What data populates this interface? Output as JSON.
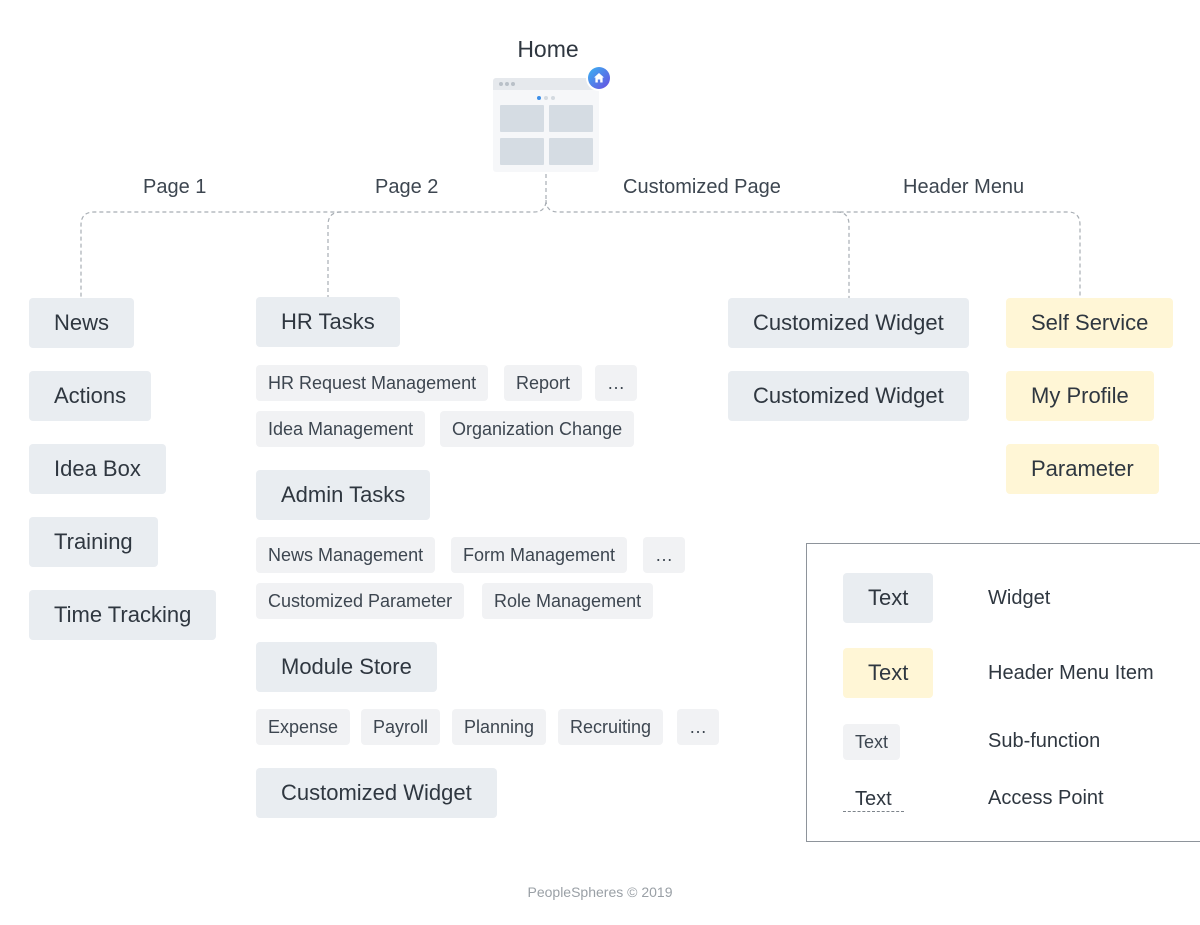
{
  "home": {
    "title": "Home",
    "icon": "home-icon"
  },
  "branches": {
    "page1": "Page 1",
    "page2": "Page 2",
    "customized_page": "Customized Page",
    "header_menu": "Header Menu"
  },
  "page1_widgets": [
    "News",
    "Actions",
    "Idea Box",
    "Training",
    "Time Tracking"
  ],
  "page2": {
    "hr_tasks": {
      "label": "HR Tasks",
      "subs": [
        "HR Request Management",
        "Report",
        "…",
        "Idea Management",
        "Organization Change"
      ]
    },
    "admin_tasks": {
      "label": "Admin Tasks",
      "subs": [
        "News Management",
        "Form Management",
        "…",
        "Customized Parameter",
        "Role Management"
      ]
    },
    "module_store": {
      "label": "Module Store",
      "subs": [
        "Expense",
        "Payroll",
        "Planning",
        "Recruiting",
        "…"
      ]
    },
    "customized_widget": "Customized Widget"
  },
  "customized_page_widgets": [
    "Customized Widget",
    "Customized Widget"
  ],
  "header_menu_items": [
    "Self Service",
    "My Profile",
    "Parameter"
  ],
  "legend": {
    "widget": {
      "sample": "Text",
      "desc": "Widget"
    },
    "header_menu_item": {
      "sample": "Text",
      "desc": "Header Menu Item"
    },
    "sub_function": {
      "sample": "Text",
      "desc": "Sub-function"
    },
    "access_point": {
      "sample": "Text",
      "desc": "Access Point"
    }
  },
  "footer": "PeopleSpheres © 2019",
  "colors": {
    "widget": "#e9edf1",
    "header_menu_item": "#fff6d6",
    "sub_function": "#f1f2f4",
    "connector": "#a8aeb4",
    "badge_gradient_start": "#3ab4f2",
    "badge_gradient_end": "#6a4de0"
  }
}
